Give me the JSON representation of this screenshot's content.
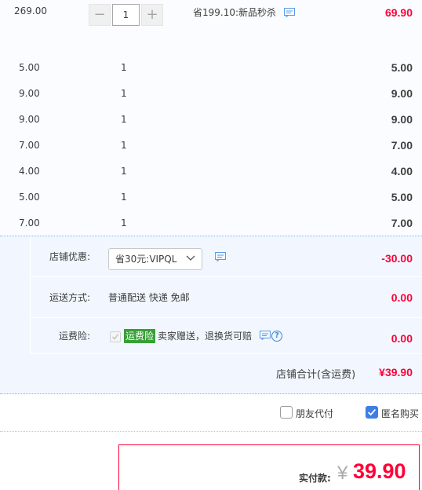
{
  "item": {
    "unit_price": "269.00",
    "quantity": "1",
    "minus_symbol": "−",
    "plus_symbol": "+",
    "promo_text": "省199.10:新品秒杀",
    "total": "69.90"
  },
  "sub_items": [
    {
      "price": "5.00",
      "qty": "1",
      "total": "5.00"
    },
    {
      "price": "9.00",
      "qty": "1",
      "total": "9.00"
    },
    {
      "price": "9.00",
      "qty": "1",
      "total": "9.00"
    },
    {
      "price": "7.00",
      "qty": "1",
      "total": "7.00"
    },
    {
      "price": "4.00",
      "qty": "1",
      "total": "4.00"
    },
    {
      "price": "5.00",
      "qty": "1",
      "total": "5.00"
    },
    {
      "price": "7.00",
      "qty": "1",
      "total": "7.00"
    }
  ],
  "shop": {
    "coupon_label": "店铺优惠:",
    "coupon_selected": "省30元:VIPQL",
    "coupon_value": "-30.00",
    "shipping_label": "运送方式:",
    "shipping_text": "普通配送 快递 免邮",
    "shipping_value": "0.00",
    "insurance_label": "运费险:",
    "insurance_badge": "运费险",
    "insurance_text": "卖家赠送，退换货可赔",
    "insurance_value": "0.00",
    "total_label": "店铺合计(含运费)",
    "total_value": "¥39.90"
  },
  "options": {
    "friend_pay": "朋友代付",
    "anonymous": "匿名购买",
    "friend_pay_checked": false,
    "anonymous_checked": true
  },
  "payment": {
    "label": "实付款:",
    "currency": "¥",
    "amount": "39.90"
  },
  "colors": {
    "accent_red": "#ff0036",
    "checkbox_blue": "#3d7ee6",
    "badge_green": "#36a036"
  },
  "icons": {
    "chat": "chat-bubble-icon",
    "help": "question-icon",
    "dropdown": "chevron-down-icon",
    "check": "check-icon"
  }
}
